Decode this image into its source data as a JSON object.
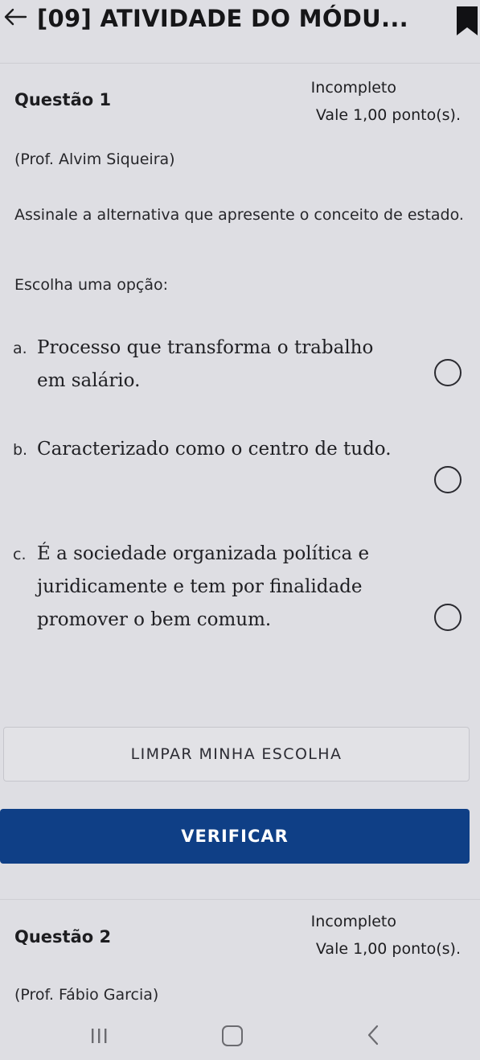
{
  "topbar": {
    "back_icon": "arrow-left-icon",
    "title": "[09] ATIVIDADE DO MÓDU...",
    "bookmark_icon": "bookmark-icon"
  },
  "question1": {
    "title": "Questão 1",
    "status": "Incompleto",
    "points": "Vale 1,00 ponto(s).",
    "author": "(Prof. Alvim Siqueira)",
    "text": "Assinale a alternativa que apresente o conceito de estado.",
    "choose_label": "Escolha uma opção:",
    "options": [
      {
        "letter": "a.",
        "text": "Processo que transforma o trabalho em salário.",
        "selected": false
      },
      {
        "letter": "b.",
        "text": "Caracterizado como o centro de tudo.",
        "selected": false
      },
      {
        "letter": "c.",
        "text": "É a sociedade organizada política e juridicamente e tem por finalidade promover o bem comum.",
        "selected": false
      }
    ],
    "clear_label": "LIMPAR MINHA ESCOLHA",
    "verify_label": "VERIFICAR"
  },
  "question2": {
    "title": "Questão 2",
    "status": "Incompleto",
    "points": "Vale 1,00 ponto(s).",
    "author": "(Prof. Fábio Garcia)"
  },
  "colors": {
    "background": "#dedee3",
    "primary_button": "#0f3f86",
    "text": "#1f1f22"
  },
  "navbar": {
    "recent_icon": "recent-apps-icon",
    "home_icon": "home-icon",
    "back_icon": "chevron-left-icon"
  }
}
